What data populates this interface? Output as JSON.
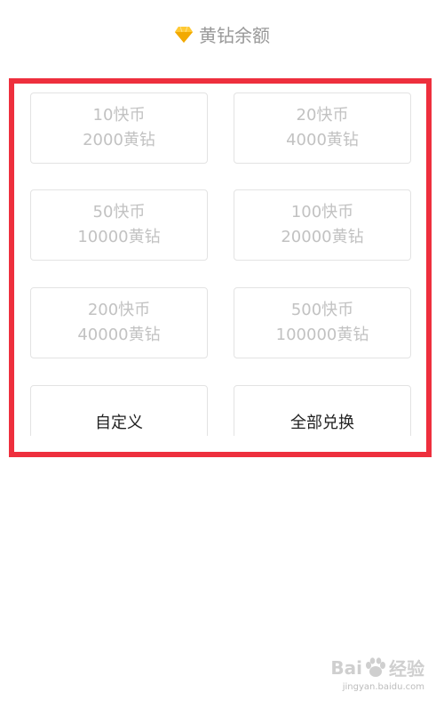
{
  "header": {
    "title": "黄钻余额",
    "icon": "diamond-icon",
    "icon_color": "#f5b301"
  },
  "options": [
    {
      "line1": "10快币",
      "line2": "2000黄钻"
    },
    {
      "line1": "20快币",
      "line2": "4000黄钻"
    },
    {
      "line1": "50快币",
      "line2": "10000黄钻"
    },
    {
      "line1": "100快币",
      "line2": "20000黄钻"
    },
    {
      "line1": "200快币",
      "line2": "40000黄钻"
    },
    {
      "line1": "500快币",
      "line2": "100000黄钻"
    }
  ],
  "actions": {
    "custom_label": "自定义",
    "exchange_all_label": "全部兑换"
  },
  "highlight_color": "#ee2f3d",
  "watermark": {
    "brand_left": "Bai",
    "brand_right": "经验",
    "url": "jingyan.baidu.com"
  }
}
